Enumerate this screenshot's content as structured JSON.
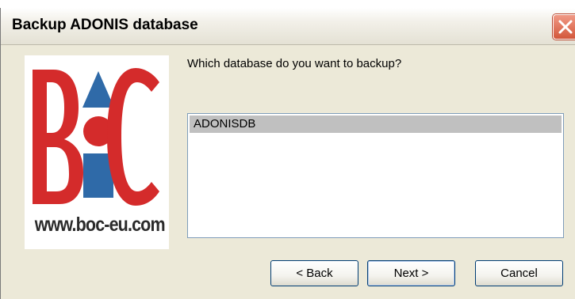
{
  "window": {
    "title": "Backup ADONIS database"
  },
  "logo": {
    "url_text": "www.boc-eu.com",
    "colors": {
      "red": "#d42b2b",
      "blue": "#2f6aa8"
    }
  },
  "dialog": {
    "prompt": "Which database do you want to backup?",
    "databases": [
      {
        "name": "ADONISDB",
        "selected": true
      }
    ]
  },
  "buttons": {
    "back": "< Back",
    "next": "Next >",
    "cancel": "Cancel"
  }
}
